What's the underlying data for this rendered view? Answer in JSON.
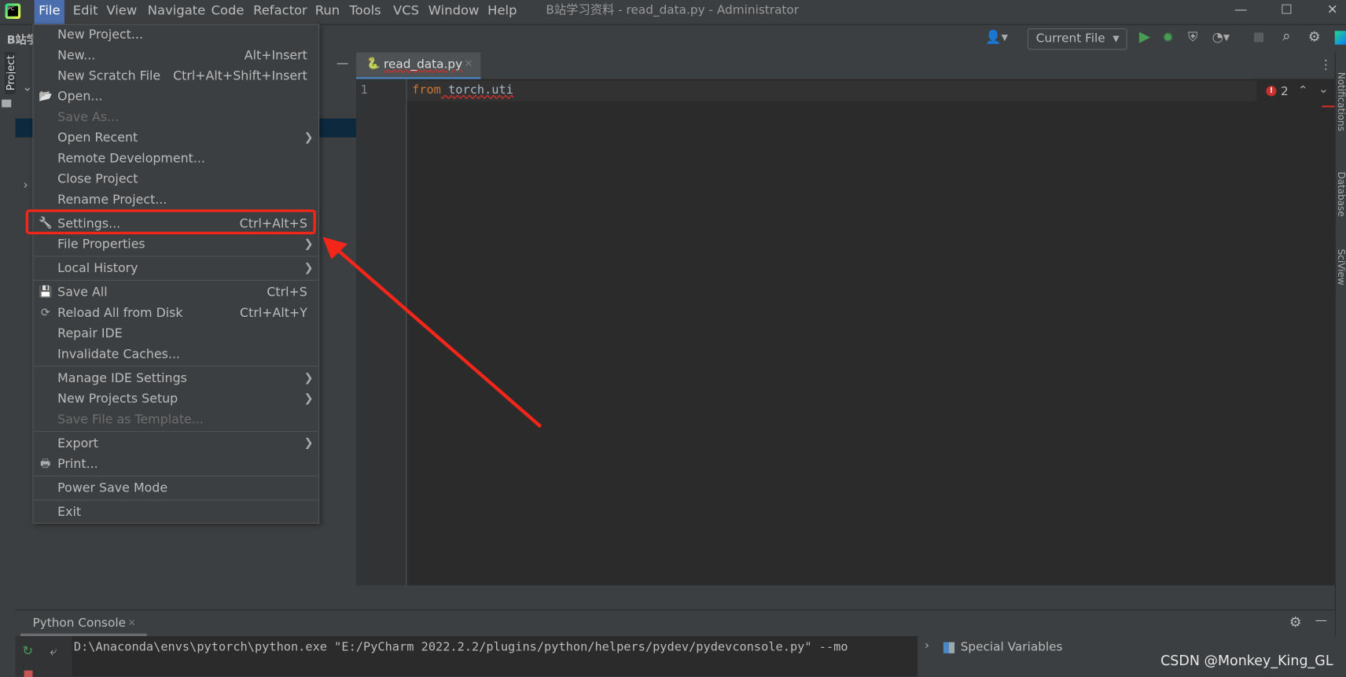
{
  "window": {
    "title": "B站学习资料 - read_data.py - Administrator",
    "menu": [
      "File",
      "Edit",
      "View",
      "Navigate",
      "Code",
      "Refactor",
      "Run",
      "Tools",
      "VCS",
      "Window",
      "Help"
    ],
    "active_menu": "File"
  },
  "toolbar": {
    "project_name": "B站学",
    "run_config": "Current File"
  },
  "left_stripe": {
    "project_label": "Project"
  },
  "editor": {
    "tab": "read_data.py",
    "line_number": "1",
    "code_keyword": "from",
    "code_rest": " torch.uti",
    "error_count": "2",
    "error_color": "#c9302c"
  },
  "right_stripe": [
    "Notifications",
    "Database",
    "SciView"
  ],
  "file_menu": {
    "items": [
      {
        "label": "New Project..."
      },
      {
        "label": "New...",
        "shortcut": "Alt+Insert"
      },
      {
        "label": "New Scratch File",
        "shortcut": "Ctrl+Alt+Shift+Insert"
      },
      {
        "label": "Open...",
        "icon": "folder-icon"
      },
      {
        "label": "Save As...",
        "disabled": true
      },
      {
        "label": "Open Recent",
        "submenu": true
      },
      {
        "label": "Remote Development..."
      },
      {
        "label": "Close Project"
      },
      {
        "label": "Rename Project..."
      },
      {
        "separator": true
      },
      {
        "label": "Settings...",
        "shortcut": "Ctrl+Alt+S",
        "icon": "wrench-icon",
        "highlighted": true
      },
      {
        "label": "File Properties",
        "submenu": true
      },
      {
        "separator": true
      },
      {
        "label": "Local History",
        "submenu": true
      },
      {
        "separator": true
      },
      {
        "label": "Save All",
        "shortcut": "Ctrl+S",
        "icon": "save-icon"
      },
      {
        "label": "Reload All from Disk",
        "shortcut": "Ctrl+Alt+Y",
        "icon": "reload-icon"
      },
      {
        "label": "Repair IDE"
      },
      {
        "label": "Invalidate Caches..."
      },
      {
        "separator": true
      },
      {
        "label": "Manage IDE Settings",
        "submenu": true
      },
      {
        "label": "New Projects Setup",
        "submenu": true
      },
      {
        "label": "Save File as Template...",
        "disabled": true
      },
      {
        "separator": true
      },
      {
        "label": "Export",
        "submenu": true
      },
      {
        "label": "Print...",
        "icon": "print-icon"
      },
      {
        "separator": true
      },
      {
        "label": "Power Save Mode"
      },
      {
        "separator": true
      },
      {
        "label": "Exit"
      }
    ]
  },
  "annotation": {
    "color": "#f4261a"
  },
  "bottom": {
    "tab": "Python Console",
    "console_line": "D:\\Anaconda\\envs\\pytorch\\python.exe \"E:/PyCharm 2022.2.2/plugins/python/helpers/pydev/pydevconsole.py\" --mo",
    "variables_label": "Special Variables"
  },
  "watermark": "CSDN @Monkey_King_GL"
}
